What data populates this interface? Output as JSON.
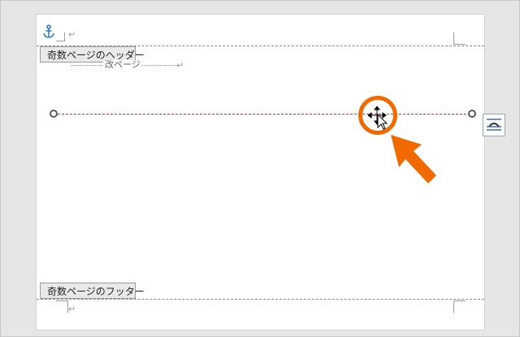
{
  "document": {
    "header_tag": "奇数ページのヘッダー",
    "footer_tag": "奇数ページのフッター",
    "section_break_label": "改ページ",
    "paragraph_mark": "↵"
  },
  "icons": {
    "anchor": "anchor-icon",
    "layout_options": "layout-options-icon",
    "move_cursor": "move-cursor-icon",
    "callout_arrow": "arrow-icon"
  },
  "colors": {
    "highlight": "#f06a00",
    "anchor": "#2b7cd3",
    "line": "#c0392b"
  }
}
